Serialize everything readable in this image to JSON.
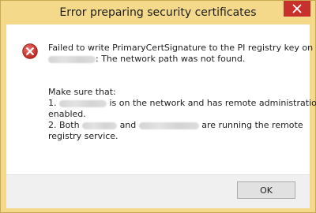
{
  "dialog": {
    "title": "Error preparing security certificates",
    "close_icon": "close-icon",
    "error_icon": "error-icon"
  },
  "message": {
    "line1": "Failed to write PrimaryCertSignature to the PI registry key on",
    "line2_suffix": ": The network path was not found.",
    "make_sure": "Make sure that:",
    "item1_prefix": "1.",
    "item1_suffix": "is on the network and has remote administration",
    "item1_cont": "enabled.",
    "item2_prefix": "2. Both",
    "item2_mid": "and",
    "item2_suffix": "are running the remote",
    "item2_cont": "registry service."
  },
  "buttons": {
    "ok_label": "OK"
  }
}
